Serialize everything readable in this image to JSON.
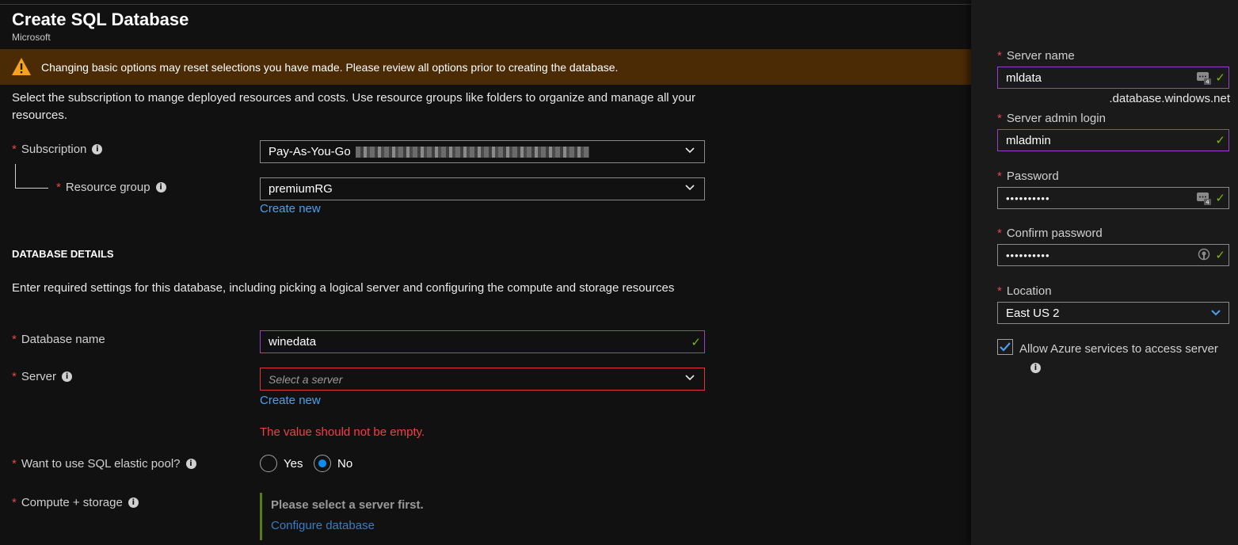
{
  "header": {
    "title": "Create SQL Database",
    "subtitle": "Microsoft"
  },
  "warning": {
    "text": "Changing basic options may reset selections you have made. Please review all options prior to creating the database."
  },
  "intro": {
    "text": "Select the subscription to mange deployed resources and costs. Use resource groups like folders to organize and manage all your resources."
  },
  "subscription": {
    "label": "Subscription",
    "value": "Pay-As-You-Go"
  },
  "resource_group": {
    "label": "Resource group",
    "value": "premiumRG",
    "create_new": "Create new"
  },
  "database_details": {
    "heading": "DATABASE DETAILS",
    "text": "Enter required settings for this database, including picking a logical server and configuring the compute and storage resources"
  },
  "database_name": {
    "label": "Database name",
    "value": "winedata"
  },
  "server": {
    "label": "Server",
    "placeholder": "Select a server",
    "create_new": "Create new",
    "error": "The value should not be empty."
  },
  "elastic_pool": {
    "label": "Want to use SQL elastic pool?",
    "yes": "Yes",
    "no": "No",
    "selected": "No"
  },
  "compute": {
    "label": "Compute + storage",
    "message": "Please select a server first.",
    "link": "Configure database"
  },
  "new_server": {
    "server_name": {
      "label": "Server name",
      "value": "mldata",
      "suffix": ".database.windows.net"
    },
    "admin_login": {
      "label": "Server admin login",
      "value": "mladmin"
    },
    "password": {
      "label": "Password",
      "value": "••••••••••"
    },
    "confirm_password": {
      "label": "Confirm password",
      "value": "••••••••••"
    },
    "location": {
      "label": "Location",
      "value": "East US 2"
    },
    "allow_azure": {
      "label": "Allow Azure services to access server",
      "checked": true
    }
  },
  "colors": {
    "accent": "#4aa0f0",
    "required": "#e8464b",
    "valid": "#7fba00",
    "warning_bg": "#4a2b05",
    "focus_border": "#9b3fc6"
  }
}
